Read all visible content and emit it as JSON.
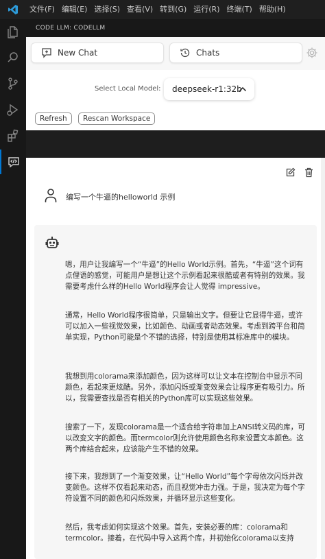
{
  "menu": [
    "文件(F)",
    "编辑(E)",
    "选择(S)",
    "查看(V)",
    "转到(G)",
    "运行(R)",
    "终端(T)",
    "帮助(H)"
  ],
  "panel": {
    "title": "CODE LLM: CODELLM"
  },
  "toolbar": {
    "new_chat": "New Chat",
    "chats": "Chats"
  },
  "model": {
    "label": "Select Local Model:",
    "selected": "deepseek-r1:32b"
  },
  "actions": {
    "refresh": "Refresh",
    "rescan": "Rescan Workspace"
  },
  "chat": {
    "user_message": "编写一个牛逼的helloworld 示例",
    "assistant_paragraphs": [
      "嗯，用户让我编写一个“牛逼”的Hello World示例。首先，“牛逼”这个词有点俚语的感觉，可能用户是想让这个示例看起来很酷或者有特别的效果。我需要考虑什么样的Hello World程序会让人觉得 impressive。",
      "通常，Hello World程序很简单，只是输出文字。但要让它显得牛逼，或许可以加入一些视觉效果，比如颜色、动画或者动态效果。考虑到跨平台和简单实现，Python可能是个不错的选择，特别是使用其标准库中的模块。",
      "我想到用colorama来添加颜色，因为这样可以让文本在控制台中显示不同颜色，看起来更炫酷。另外，添加闪烁或渐变效果会让程序更有吸引力。所以，我需要查找是否有相关的Python库可以实现这些效果。",
      "搜索了一下，发现colorama是一个适合给字符串加上ANSI转义码的库，可以改变文字的颜色。而termcolor则允许使用颜色名称来设置文本颜色。这两个库结合起来，应该能产生不错的效果。",
      "接下来，我想到了一个渐变效果，让“Hello World”每个字母依次闪烁并改变颜色。这样不仅看起来动态，而且视觉冲击力强。于是，我决定为每个字符设置不同的颜色和闪烁效果，并循环显示这些变化。",
      "然后，我考虑如何实现这个效果。首先，安装必要的库：colorama和termcolor。接着，在代码中导入这两个库，并初始化colorama以支持"
    ]
  },
  "icons": {
    "logo": "vscode-logo-icon",
    "activity": [
      "explorer-icon",
      "search-icon",
      "source-control-icon",
      "run-debug-icon",
      "extensions-icon",
      "code-llm-chat-icon"
    ]
  },
  "colors": {
    "accent": "#0078d4",
    "titlebar": "#1f1f1f",
    "activitybar": "#181818"
  }
}
